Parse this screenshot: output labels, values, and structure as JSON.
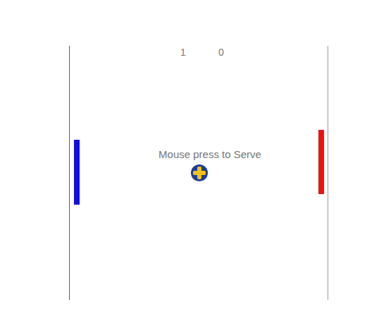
{
  "scoreboard": {
    "scores": [
      "1",
      "0"
    ]
  },
  "message": "Mouse press to Serve",
  "paddles": [
    {
      "side": "left",
      "color": "#1010e0"
    },
    {
      "side": "right",
      "color": "#ee1111"
    }
  ]
}
